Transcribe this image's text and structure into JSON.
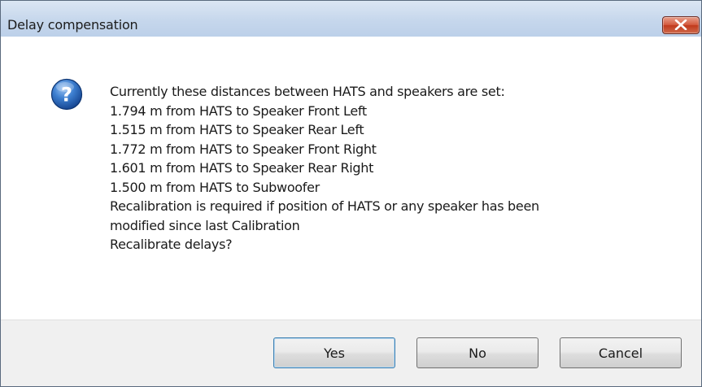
{
  "window": {
    "title": "Delay compensation"
  },
  "icons": {
    "dialog_icon": "question-icon",
    "close_icon": "close-icon"
  },
  "message": {
    "lines": [
      "Currently these distances between HATS and speakers are set:",
      "1.794 m from HATS to Speaker Front Left",
      "1.515 m from HATS to Speaker Rear Left",
      "1.772 m from HATS to Speaker Front Right",
      "1.601 m from HATS to Speaker Rear Right",
      "1.500 m from HATS to Subwoofer",
      "Recalibration is required if position of HATS or any speaker has been",
      "modified since last Calibration",
      "Recalibrate delays?"
    ]
  },
  "buttons": {
    "yes": "Yes",
    "no": "No",
    "cancel": "Cancel"
  },
  "colors": {
    "titlebar": "#c6d7ec",
    "close_button": "#c0391b",
    "footer": "#f0f0f0",
    "question_icon": "#1f5cae"
  }
}
